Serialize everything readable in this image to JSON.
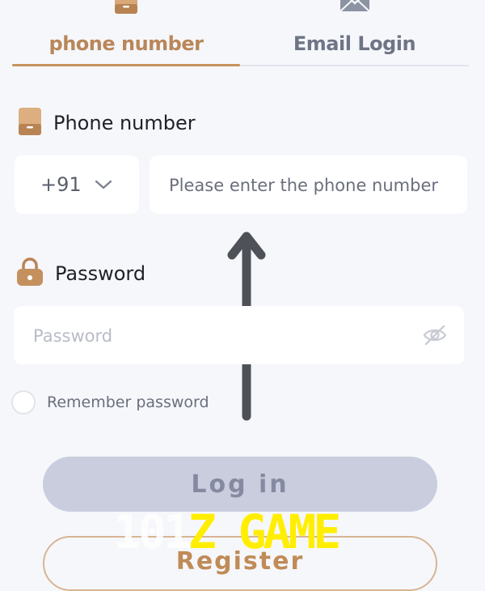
{
  "tabs": [
    {
      "label": "phone number",
      "icon": "phone-icon",
      "active": true
    },
    {
      "label": "Email Login",
      "icon": "mail-icon",
      "active": false
    }
  ],
  "phone_section": {
    "label": "Phone number",
    "icon": "phone-icon",
    "country_code": "+91",
    "input_placeholder": "Please enter the phone number",
    "input_value": ""
  },
  "password_section": {
    "label": "Password",
    "icon": "lock-icon",
    "input_placeholder": "Password",
    "input_value": "",
    "visibility_icon": "eye-off-icon"
  },
  "remember": {
    "label": "Remember password",
    "checked": false
  },
  "buttons": {
    "login": "Log in",
    "register": "Register"
  },
  "overlay": {
    "arrow_icon": "arrow-up-icon"
  },
  "watermark": {
    "part1": "101",
    "part2": "Z GAME"
  },
  "colors": {
    "accent": "#c6935f",
    "active_tab_text": "#b9875a",
    "inactive_tab_text": "#6e7585",
    "login_bg": "#cacdde",
    "login_text": "#858aa0",
    "register_border": "#d7b594",
    "watermark_yellow": "#ffee00",
    "background": "#f6f7fb"
  }
}
